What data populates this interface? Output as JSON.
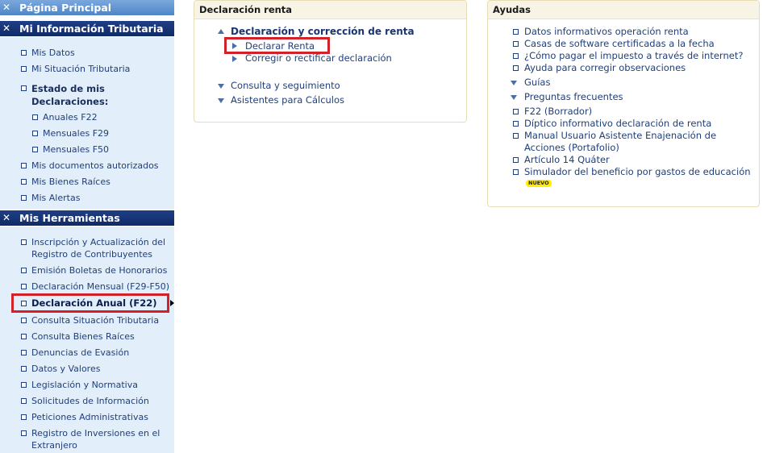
{
  "sidebar": {
    "home": {
      "label": "Página Principal"
    },
    "info": {
      "title": "Mi Información Tributaria",
      "items": [
        {
          "label": "Mis Datos"
        },
        {
          "label": "Mi Situación Tributaria"
        }
      ],
      "group_label": "Estado de mis Declaraciones:",
      "sub_items": [
        {
          "label": "Anuales F22"
        },
        {
          "label": "Mensuales F29"
        },
        {
          "label": "Mensuales F50"
        }
      ],
      "items_after": [
        {
          "label": "Mis documentos autorizados"
        },
        {
          "label": "Mis Bienes Raíces"
        },
        {
          "label": "Mis Alertas"
        }
      ]
    },
    "tools": {
      "title": "Mis Herramientas",
      "items": [
        {
          "label": "Inscripción y Actualización del Registro de Contribuyentes"
        },
        {
          "label": "Emisión Boletas de Honorarios"
        },
        {
          "label": "Declaración Mensual (F29-F50)"
        },
        {
          "label": "Declaración Anual (F22)"
        },
        {
          "label": "Consulta Situación Tributaria"
        },
        {
          "label": "Consulta Bienes Raíces"
        },
        {
          "label": "Denuncias de Evasión"
        },
        {
          "label": "Datos y Valores"
        },
        {
          "label": "Legislación y Normativa"
        },
        {
          "label": "Solicitudes de Información"
        },
        {
          "label": "Peticiones Administrativas"
        },
        {
          "label": "Registro de Inversiones en el Extranjero"
        }
      ]
    }
  },
  "declaracion_panel": {
    "title": "Declaración renta",
    "section_title": "Declaración y corrección de renta",
    "sub_links": [
      {
        "label": "Declarar Renta"
      },
      {
        "label": "Corregir o rectificar declaración"
      }
    ],
    "collapsed_sections": [
      {
        "label": "Consulta y seguimiento"
      },
      {
        "label": "Asistentes para Cálculos"
      }
    ]
  },
  "ayudas_panel": {
    "title": "Ayudas",
    "links_top": [
      {
        "label": "Datos informativos operación renta"
      },
      {
        "label": "Casas de software certificadas a la fecha"
      },
      {
        "label": "¿Cómo pagar el impuesto a través de internet?"
      },
      {
        "label": "Ayuda para corregir observaciones"
      }
    ],
    "sections": [
      {
        "label": "Guías"
      },
      {
        "label": "Preguntas frecuentes"
      }
    ],
    "links_bottom": [
      {
        "label": "F22 (Borrador)"
      },
      {
        "label": "Díptico informativo declaración de renta"
      },
      {
        "label": "Manual Usuario Asistente Enajenación de Acciones (Portafolio)"
      },
      {
        "label": "Artículo 14 Quáter"
      },
      {
        "label": "Simulador del beneficio por gastos de educación"
      }
    ],
    "new_badge": "NUEVO"
  },
  "colors": {
    "highlight": "#d3212a",
    "nav_bg": "#e3eefb",
    "header_dark": "#1f3f86",
    "header_light": "#6a9bd6",
    "link": "#1f3f7a",
    "badge": "#ffef00"
  }
}
